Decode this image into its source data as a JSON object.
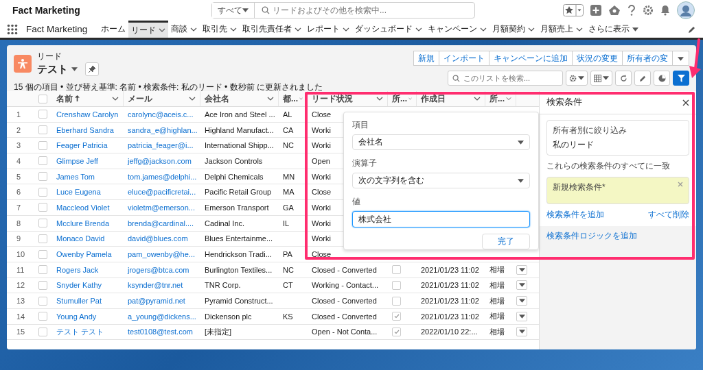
{
  "global_header": {
    "app_name": "Fact Marketing",
    "search_scope": "すべて",
    "search_placeholder": "リードおよびその他を検索中..."
  },
  "nav": {
    "app_name": "Fact Marketing",
    "items": [
      {
        "label": "ホーム",
        "selected": false,
        "has_menu": false
      },
      {
        "label": "リード",
        "selected": true,
        "has_menu": true
      },
      {
        "label": "商談",
        "selected": false,
        "has_menu": true
      },
      {
        "label": "取引先",
        "selected": false,
        "has_menu": true
      },
      {
        "label": "取引先責任者",
        "selected": false,
        "has_menu": true
      },
      {
        "label": "レポート",
        "selected": false,
        "has_menu": true
      },
      {
        "label": "ダッシュボード",
        "selected": false,
        "has_menu": true
      },
      {
        "label": "キャンペーン",
        "selected": false,
        "has_menu": true
      },
      {
        "label": "月額契約",
        "selected": false,
        "has_menu": true
      },
      {
        "label": "月額売上",
        "selected": false,
        "has_menu": true
      },
      {
        "label": "さらに表示",
        "selected": false,
        "has_menu": true
      }
    ]
  },
  "list_header": {
    "object": "リード",
    "list_name": "テスト",
    "summary": "15 個の項目 • 並び替え基準: 名前 • 検索条件: 私のリード • 数秒前 に更新されました",
    "actions": [
      "新規",
      "インポート",
      "キャンペーンに追加",
      "状況の変更",
      "所有者の変"
    ],
    "search_placeholder": "このリストを検索...",
    "filter_active": true
  },
  "table": {
    "all_selected": false,
    "columns": [
      {
        "label": "名前",
        "sorted": true
      },
      {
        "label": "メール",
        "sorted": false
      },
      {
        "label": "会社名",
        "sorted": false
      },
      {
        "label": "都...",
        "sorted": false
      },
      {
        "label": "リード状況",
        "sorted": false
      },
      {
        "label": "所...",
        "sorted": false
      },
      {
        "label": "作成日",
        "sorted": false
      },
      {
        "label": "所...",
        "sorted": false
      }
    ],
    "rows": [
      {
        "num": "1",
        "selected": false,
        "name": "Crenshaw Carolyn",
        "email": "carolync@aceis.c...",
        "company": "Ace Iron and Steel ...",
        "state": "AL",
        "status": "Close"
      },
      {
        "num": "2",
        "selected": false,
        "name": "Eberhard Sandra",
        "email": "sandra_e@highlan...",
        "company": "Highland Manufact...",
        "state": "CA",
        "status": "Worki"
      },
      {
        "num": "3",
        "selected": false,
        "name": "Feager Patricia",
        "email": "patricia_feager@i...",
        "company": "International Shipp...",
        "state": "NC",
        "status": "Worki"
      },
      {
        "num": "4",
        "selected": false,
        "name": "Glimpse Jeff",
        "email": "jeffg@jackson.com",
        "company": "Jackson Controls",
        "status": "Open"
      },
      {
        "num": "5",
        "selected": false,
        "name": "James Tom",
        "email": "tom.james@delphi...",
        "company": "Delphi Chemicals",
        "state": "MN",
        "status": "Worki"
      },
      {
        "num": "6",
        "selected": false,
        "name": "Luce Eugena",
        "email": "eluce@pacificretai...",
        "company": "Pacific Retail Group",
        "state": "MA",
        "status": "Close"
      },
      {
        "num": "7",
        "selected": false,
        "name": "Maccleod Violet",
        "email": "violetm@emerson...",
        "company": "Emerson Transport",
        "state": "GA",
        "status": "Worki"
      },
      {
        "num": "8",
        "selected": false,
        "name": "Mcclure Brenda",
        "email": "brenda@cardinal....",
        "company": "Cadinal Inc.",
        "state": "IL",
        "status": "Worki"
      },
      {
        "num": "9",
        "selected": false,
        "name": "Monaco David",
        "email": "david@blues.com",
        "company": "Blues Entertainme...",
        "status": "Worki"
      },
      {
        "num": "10",
        "selected": false,
        "name": "Owenby Pamela",
        "email": "pam_owenby@he...",
        "company": "Hendrickson Tradi...",
        "state": "PA",
        "status": "Close"
      },
      {
        "num": "11",
        "selected": false,
        "name": "Rogers Jack",
        "email": "jrogers@btca.com",
        "company": "Burlington Textiles...",
        "state": "NC",
        "status": "Closed - Converted",
        "checked": false,
        "created": "2021/01/23 11:02",
        "owner": "相場"
      },
      {
        "num": "12",
        "selected": false,
        "name": "Snyder Kathy",
        "email": "ksynder@tnr.net",
        "company": "TNR Corp.",
        "state": "CT",
        "status": "Working - Contact...",
        "checked": false,
        "created": "2021/01/23 11:02",
        "owner": "相場"
      },
      {
        "num": "13",
        "selected": false,
        "name": "Stumuller Pat",
        "email": "pat@pyramid.net",
        "company": "Pyramid Construct...",
        "status": "Closed - Converted",
        "checked": false,
        "created": "2021/01/23 11:02",
        "owner": "相場"
      },
      {
        "num": "14",
        "selected": false,
        "name": "Young Andy",
        "email": "a_young@dickens...",
        "company": "Dickenson plc",
        "state": "KS",
        "status": "Closed - Converted",
        "checked": true,
        "created": "2021/01/23 11:02",
        "owner": "相場"
      },
      {
        "num": "15",
        "selected": false,
        "name": "テスト テスト",
        "email": "test0108@test.com",
        "company": "[未指定]",
        "status": "Open - Not Conta...",
        "checked": true,
        "created": "2022/01/10 22:...",
        "owner": "相場"
      }
    ]
  },
  "filter_popup": {
    "fields": [
      {
        "label": "項目",
        "value": "会社名",
        "kind": "select"
      },
      {
        "label": "演算子",
        "value": "次の文字列を含む",
        "kind": "select"
      },
      {
        "label": "値",
        "value": "株式会社",
        "kind": "input"
      }
    ],
    "done": "完了"
  },
  "filter_panel": {
    "title": "検索条件",
    "owner_filter": {
      "label": "所有者別に絞り込み",
      "value": "私のリード"
    },
    "match_text": "これらの検索条件のすべてに一致",
    "new_filter": "新規検索条件*",
    "add_filter": "検索条件を追加",
    "remove_all": "すべて削除",
    "add_logic": "検索条件ロジックを追加"
  }
}
